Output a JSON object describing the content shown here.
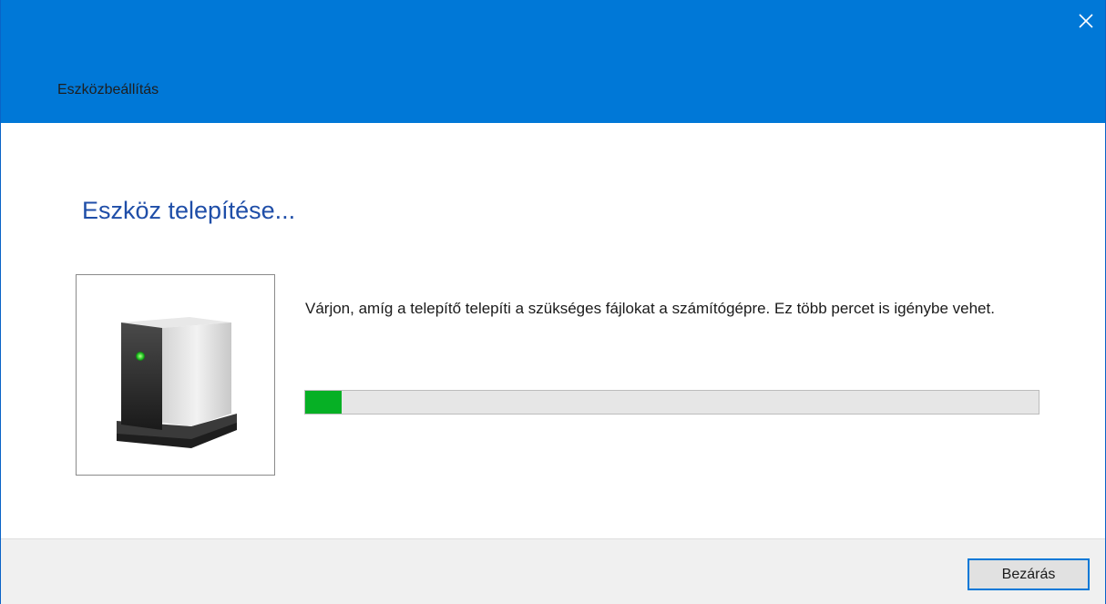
{
  "window": {
    "title": "Eszközbeállítás",
    "close_icon": "close-icon",
    "titlebar_color": "#0078d7"
  },
  "main": {
    "heading": "Eszköz telepítése...",
    "device_icon": "storage-device-icon",
    "message": "Várjon, amíg a telepítő telepíti a szükséges fájlokat a számítógépre. Ez több percet is igénybe vehet.",
    "progress": {
      "fraction": 0.05,
      "fill_color": "#06b025"
    }
  },
  "footer": {
    "close_button_label": "Bezárás"
  }
}
